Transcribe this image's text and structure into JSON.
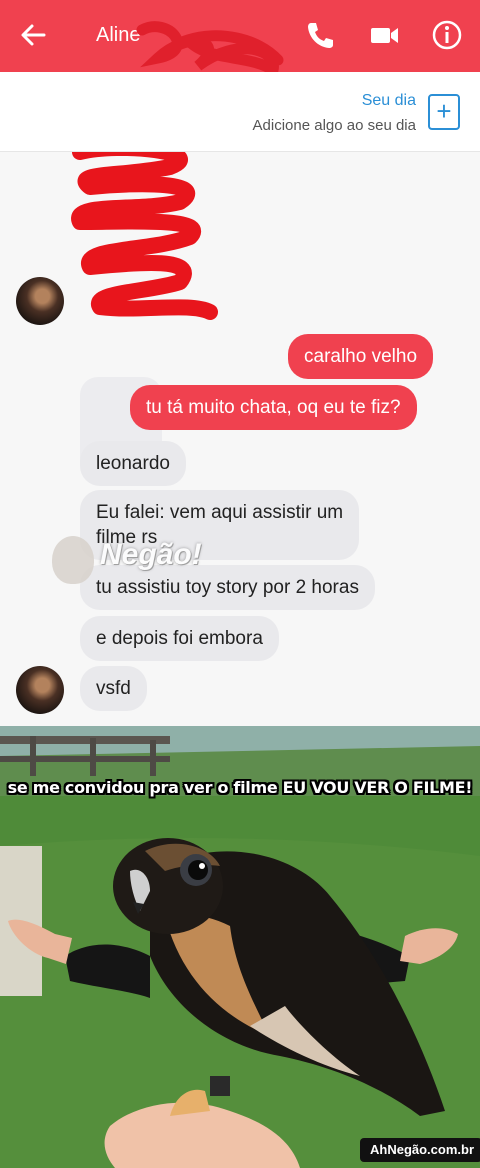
{
  "header": {
    "contact_name": "Aline",
    "back_icon": "arrow-left-icon",
    "call_icon": "phone-icon",
    "video_icon": "video-camera-icon",
    "info_icon": "info-icon",
    "bar_color": "#f0414f"
  },
  "your_day": {
    "title": "Seu dia",
    "subtitle": "Adicione algo ao seu dia",
    "add_icon": "plus-icon"
  },
  "messages": [
    {
      "side": "out",
      "text": "caralho velho"
    },
    {
      "side": "out",
      "text": "tu tá muito chata, oq eu te fiz?"
    },
    {
      "side": "in",
      "text": "leonardo"
    },
    {
      "side": "in",
      "text": "Eu falei: vem aqui assistir um\nfilme rs"
    },
    {
      "side": "in",
      "text": "tu assistiu toy story por 2 horas"
    },
    {
      "side": "in",
      "text": "e depois foi embora"
    },
    {
      "side": "in",
      "text": "vsfd"
    }
  ],
  "watermark": {
    "text": "Negão!"
  },
  "meme": {
    "caption": "se me convidou pra ver o filme EU VOU VER O FILME!",
    "badge": "AhNegão.com.br"
  },
  "colors": {
    "outgoing": "#f0414f",
    "incoming": "#e9e9ec",
    "accent": "#2b8fd6"
  }
}
